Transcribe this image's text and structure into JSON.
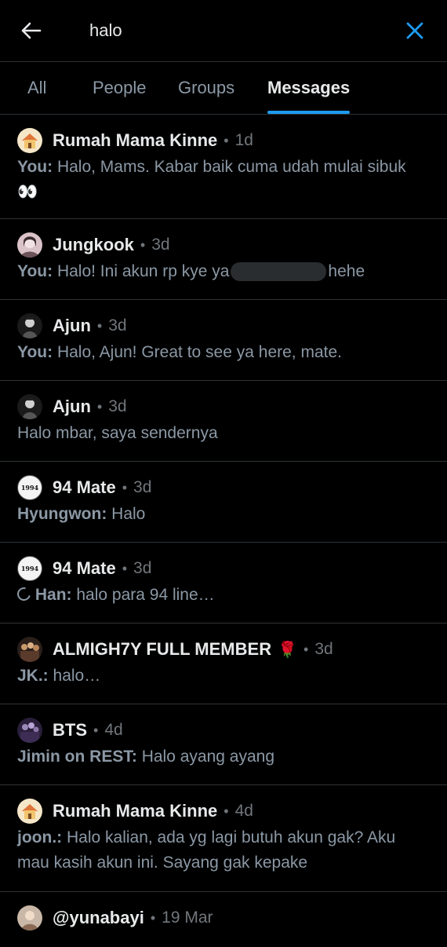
{
  "search": {
    "query": "halo"
  },
  "tabs": [
    {
      "label": "All",
      "active": false
    },
    {
      "label": "People",
      "active": false
    },
    {
      "label": "Groups",
      "active": false
    },
    {
      "label": "Messages",
      "active": true
    }
  ],
  "results": [
    {
      "name": "Rumah Mama Kinne",
      "time": "1d",
      "sender": "You:",
      "text": "Halo, Mams. Kabar baik cuma udah mulai sibuk",
      "emoji": "👀",
      "avatar_icon": "house-icon"
    },
    {
      "name": "Jungkook",
      "time": "3d",
      "sender": "You:",
      "text_before": "Halo! Ini akun rp kye ya",
      "text_after": "hehe",
      "avatar_icon": "person-photo-icon"
    },
    {
      "name": "Ajun",
      "time": "3d",
      "sender": "You:",
      "text": "Halo, Ajun! Great to see ya here, mate.",
      "avatar_icon": "person-photo-icon"
    },
    {
      "name": "Ajun",
      "time": "3d",
      "sender": "",
      "text": "Halo mbar, saya sendernya",
      "avatar_icon": "person-photo-icon"
    },
    {
      "name": "94 Mate",
      "time": "3d",
      "sender": "Hyungwon:",
      "text": "Halo",
      "avatar_label": "1994"
    },
    {
      "name": "94 Mate",
      "time": "3d",
      "sender": "Han:",
      "text": "halo para 94 line…",
      "avatar_label": "1994"
    },
    {
      "name": "ALMIGH7Y FULL MEMBER",
      "name_emoji": "🌹",
      "time": "3d",
      "sender": "JK.:",
      "text": "halo…",
      "avatar_icon": "group-photo-icon"
    },
    {
      "name": "BTS",
      "time": "4d",
      "sender": "Jimin on REST:",
      "text": "Halo ayang ayang",
      "avatar_icon": "group-photo-icon"
    },
    {
      "name": "Rumah Mama Kinne",
      "time": "4d",
      "sender": "joon.:",
      "text": "Halo kalian, ada yg lagi butuh akun gak? Aku mau kasih akun ini. Sayang gak kepake",
      "avatar_icon": "house-icon"
    },
    {
      "name": "@yunabayi",
      "time": "19 Mar",
      "sender": "",
      "text": "",
      "avatar_icon": "person-photo-icon"
    }
  ],
  "dot": "•",
  "colors": {
    "accent": "#1d9bf0",
    "background": "#000000",
    "muted": "#8b98a5"
  }
}
